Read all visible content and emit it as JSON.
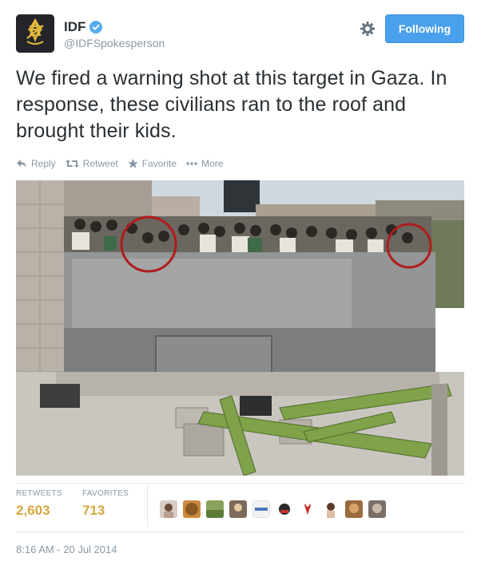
{
  "author": {
    "name": "IDF",
    "handle": "@IDFSpokesperson",
    "logo_color": "#e3b83a"
  },
  "follow_button": {
    "label": "Following",
    "color": "#4aa0ec"
  },
  "tweet": {
    "text": "We fired a warning shot at this target in Gaza. In response, these civilians ran to the roof and brought their kids."
  },
  "actions": {
    "reply": "Reply",
    "retweet": "Retweet",
    "favorite": "Favorite",
    "more": "More"
  },
  "stats": {
    "retweets_label": "RETWEETS",
    "retweets_value": "2,603",
    "favorites_label": "FAVORITES",
    "favorites_value": "713",
    "value_color": "#d6a73b"
  },
  "icons": [
    "gear-icon",
    "verified-badge-icon",
    "reply-icon",
    "retweet-icon",
    "star-icon",
    "more-dots-icon"
  ],
  "timestamp": "8:16 AM - 20 Jul 2014"
}
